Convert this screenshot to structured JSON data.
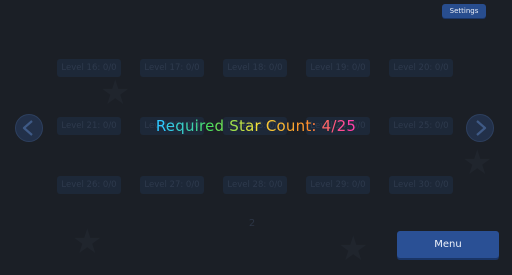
{
  "header": {
    "settings_label": "Settings"
  },
  "level_rows": [
    [
      "Level 16: 0/0",
      "Level 17: 0/0",
      "Level 18: 0/0",
      "Level 19: 0/0",
      "Level 20: 0/0"
    ],
    [
      "Level 21: 0/0",
      "Level 22: 0/0",
      "Level 23: 0/0",
      "Level 24: 0/0",
      "Level 25: 0/0"
    ],
    [
      "Level 26: 0/0",
      "Level 27: 0/0",
      "Level 28: 0/0",
      "Level 29: 0/0",
      "Level 30: 0/0"
    ]
  ],
  "overlay": {
    "text": "Required Star Count: 4/25"
  },
  "pagination": {
    "page_number": "2"
  },
  "footer": {
    "menu_label": "Menu"
  },
  "colors": {
    "accent_button": "#2a5095",
    "overlay_gradient": [
      "#2ec7ff",
      "#4bdc5e",
      "#f3e03a",
      "#ff8b2a",
      "#ff3fa6"
    ]
  },
  "icons": {
    "prev": "chevron-left-icon",
    "next": "chevron-right-icon",
    "background": "star-icon"
  }
}
